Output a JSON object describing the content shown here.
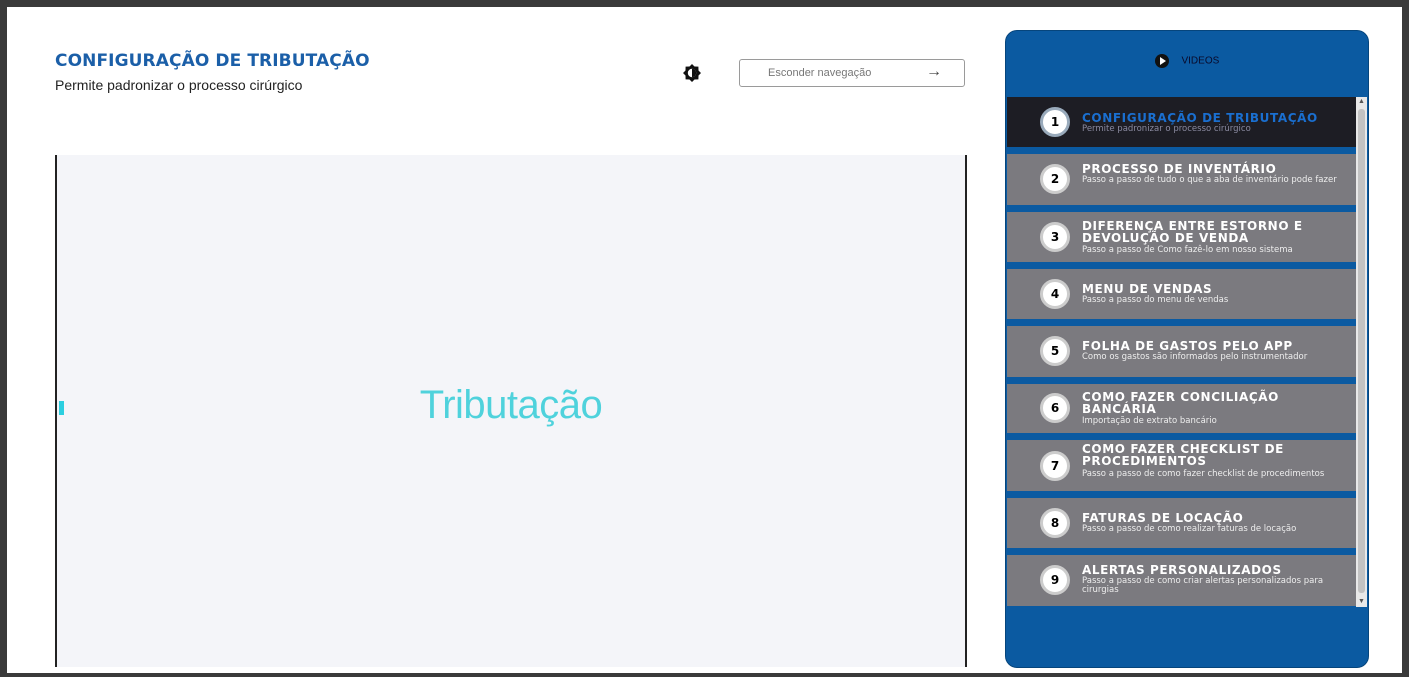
{
  "header": {
    "title": "CONFIGURAÇÃO DE TRIBUTAÇÃO",
    "subtitle": "Permite padronizar o processo cirúrgico",
    "hide_nav_label": "Esconder navegação",
    "hide_nav_arrow": "→"
  },
  "video": {
    "title": "Tributação"
  },
  "panel": {
    "header_label": "VIDEOS",
    "items": [
      {
        "number": "1",
        "title": "CONFIGURAÇÃO DE TRIBUTAÇÃO",
        "description": "Permite padronizar o processo cirúrgico",
        "active": true
      },
      {
        "number": "2",
        "title": "PROCESSO DE INVENTÁRIO",
        "description": "Passo a passo de tudo o que a aba de inventário pode fazer"
      },
      {
        "number": "3",
        "title": "DIFERENÇA ENTRE ESTORNO E DEVOLUÇÃO DE VENDA",
        "description": "Passo a passo de Como fazê-lo em nosso sistema"
      },
      {
        "number": "4",
        "title": "MENU DE VENDAS",
        "description": "Passo a passo do menu de vendas"
      },
      {
        "number": "5",
        "title": "FOLHA DE GASTOS PELO APP",
        "description": "Como os gastos são informados pelo instrumentador"
      },
      {
        "number": "6",
        "title": "COMO FAZER CONCILIAÇÃO BANCÁRIA",
        "description": "Importação de extrato bancário"
      },
      {
        "number": "7",
        "title": "COMO FAZER CHECKLIST DE PROCEDIMENTOS",
        "description": "Passo a passo de como fazer checklist de procedimentos"
      },
      {
        "number": "8",
        "title": "FATURAS DE LOCAÇÃO",
        "description": "Passo a passo de como realizar faturas de locação"
      },
      {
        "number": "9",
        "title": "ALERTAS PERSONALIZADOS",
        "description": "Passo a passo de como criar alertas personalizados para cirurgias"
      }
    ]
  },
  "colors": {
    "accent": "#1b5fa8",
    "panel_bg": "#0b5aa1",
    "item_bg": "#7b7a7f",
    "item_active_bg": "#1d1d24",
    "video_title": "#4fd2dc"
  }
}
